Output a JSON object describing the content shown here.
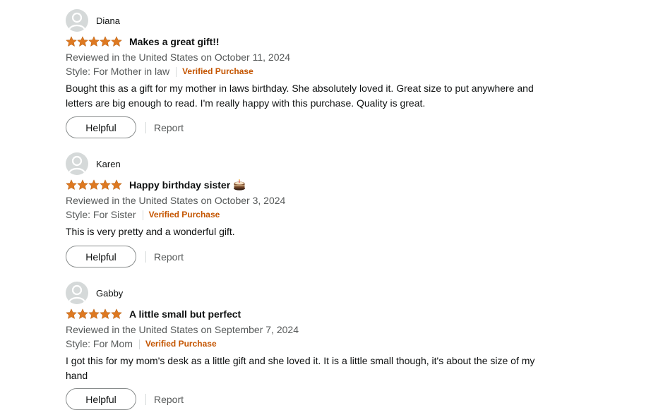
{
  "colors": {
    "star": "#de7921",
    "verified": "#c45500",
    "secondary_text": "#565959"
  },
  "reviews": [
    {
      "name": "Diana",
      "rating": 5,
      "title": "Makes a great gift!!",
      "emoji": "",
      "date": "Reviewed in the United States on October 11, 2024",
      "style": "Style: For Mother in law",
      "verified": "Verified Purchase",
      "body": "Bought this as a gift for my mother in laws birthday. She absolutely loved it. Great size to put anywhere and letters are big enough to read. I'm really happy with this purchase. Quality is great.",
      "helpful": "Helpful",
      "report": "Report"
    },
    {
      "name": "Karen",
      "rating": 5,
      "title": "Happy birthday sister",
      "emoji": "cake-icon",
      "date": "Reviewed in the United States on October 3, 2024",
      "style": "Style: For Sister",
      "verified": "Verified Purchase",
      "body": "This is very pretty and a wonderful gift.",
      "helpful": "Helpful",
      "report": "Report"
    },
    {
      "name": "Gabby",
      "rating": 5,
      "title": "A little small but perfect",
      "emoji": "",
      "date": "Reviewed in the United States on September 7, 2024",
      "style": "Style: For Mom",
      "verified": "Verified Purchase",
      "body": "I got this for my mom's desk as a little gift and she loved it. It is a little small though, it's about the size of my hand",
      "helpful": "Helpful",
      "report": "Report"
    }
  ]
}
